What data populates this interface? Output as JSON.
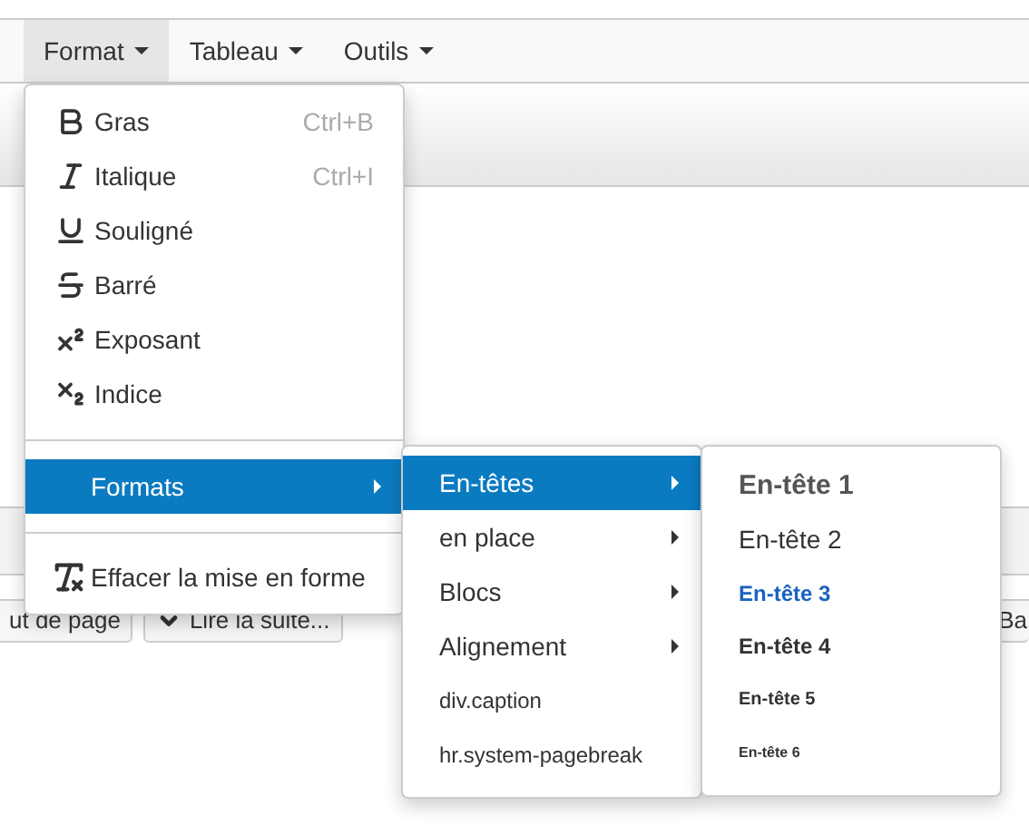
{
  "menubar": [
    {
      "label": "Format",
      "selected": true
    },
    {
      "label": "Tableau",
      "selected": false
    },
    {
      "label": "Outils",
      "selected": false
    }
  ],
  "toolbar_buttons": [
    {
      "label": "ut de page",
      "kind": "plain"
    },
    {
      "label": "Lire la suite...",
      "kind": "chevron"
    },
    {
      "label": "Ba",
      "kind": "plain"
    }
  ],
  "format_menu": {
    "items": [
      {
        "kind": "bold",
        "label": "Gras",
        "shortcut": "Ctrl+B"
      },
      {
        "kind": "italic",
        "label": "Italique",
        "shortcut": "Ctrl+I"
      },
      {
        "kind": "underline",
        "label": "Souligné"
      },
      {
        "kind": "strike",
        "label": "Barré"
      },
      {
        "kind": "superscript",
        "label": "Exposant"
      },
      {
        "kind": "subscript",
        "label": "Indice"
      }
    ],
    "formats": {
      "label": "Formats",
      "selected": true
    },
    "clear": {
      "label": "Effacer la mise en forme"
    }
  },
  "formats_menu": {
    "items": [
      {
        "label": "En-têtes",
        "has_submenu": true,
        "selected": true
      },
      {
        "label": "en place",
        "has_submenu": true,
        "selected": false
      },
      {
        "label": "Blocs",
        "has_submenu": true,
        "selected": false
      },
      {
        "label": "Alignement",
        "has_submenu": true,
        "selected": false
      },
      {
        "label": "div.caption",
        "has_submenu": false,
        "selected": false
      },
      {
        "label": "hr.system-pagebreak",
        "has_submenu": false,
        "selected": false
      }
    ]
  },
  "headings_menu": {
    "items": [
      {
        "label": "En-tête 1",
        "kind": "h1",
        "selected": false
      },
      {
        "label": "En-tête 2",
        "kind": "h2",
        "selected": false
      },
      {
        "label": "En-tête 3",
        "kind": "h3",
        "selected": true
      },
      {
        "label": "En-tête 4",
        "kind": "h4",
        "selected": false
      },
      {
        "label": "En-tête 5",
        "kind": "h5",
        "selected": false
      },
      {
        "label": "En-tête 6",
        "kind": "h6",
        "selected": false
      }
    ]
  }
}
